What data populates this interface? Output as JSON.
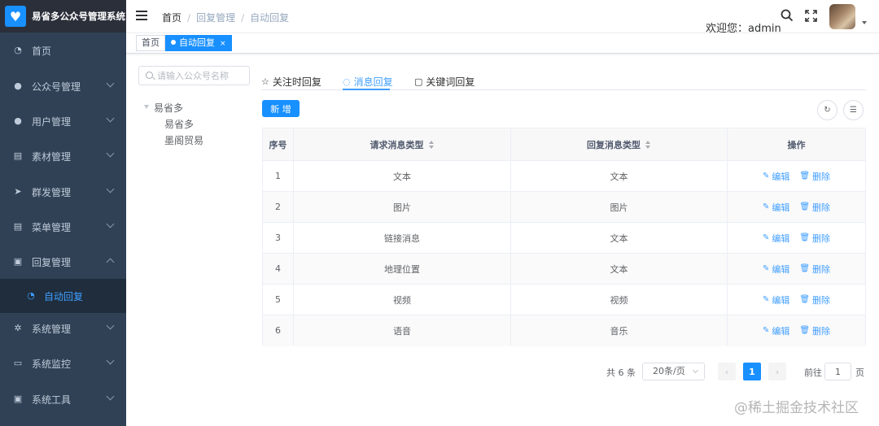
{
  "app": {
    "title": "易省多公众号管理系统",
    "brand_color": "#1890ff"
  },
  "sidebar": {
    "items": [
      {
        "label": "首页",
        "icon": "dashboard-icon"
      },
      {
        "label": "公众号管理",
        "icon": "wechat-icon"
      },
      {
        "label": "用户管理",
        "icon": "user-icon"
      },
      {
        "label": "素材管理",
        "icon": "document-icon"
      },
      {
        "label": "群发管理",
        "icon": "send-icon"
      },
      {
        "label": "菜单管理",
        "icon": "menu-doc-icon"
      },
      {
        "label": "回复管理",
        "icon": "reply-icon"
      },
      {
        "label": "自动回复",
        "icon": "dashboard-icon"
      },
      {
        "label": "系统管理",
        "icon": "gear-icon"
      },
      {
        "label": "系统监控",
        "icon": "monitor-icon"
      },
      {
        "label": "系统工具",
        "icon": "toolbox-icon"
      }
    ]
  },
  "navbar": {
    "breadcrumb": [
      "首页",
      "回复管理",
      "自动回复"
    ],
    "welcome": "欢迎您：admin"
  },
  "tags": {
    "home": "首页",
    "active": "自动回复",
    "close": "×"
  },
  "accounts": {
    "search_placeholder": "请输入公众号名称",
    "tree": {
      "root": "易省多",
      "children": [
        "易省多",
        "墨阁贸易"
      ]
    }
  },
  "reply_tabs": {
    "subscribe": "关注时回复",
    "message": "消息回复",
    "keyword": "关键词回复"
  },
  "toolbar": {
    "add_label": "新 增"
  },
  "table": {
    "headers": {
      "index": "序号",
      "request_type": "请求消息类型",
      "reply_type": "回复消息类型",
      "actions": "操作"
    },
    "rows": [
      {
        "index": "1",
        "request_type": "文本",
        "reply_type": "文本"
      },
      {
        "index": "2",
        "request_type": "图片",
        "reply_type": "图片"
      },
      {
        "index": "3",
        "request_type": "链接消息",
        "reply_type": "文本"
      },
      {
        "index": "4",
        "request_type": "地理位置",
        "reply_type": "文本"
      },
      {
        "index": "5",
        "request_type": "视频",
        "reply_type": "视频"
      },
      {
        "index": "6",
        "request_type": "语音",
        "reply_type": "音乐"
      }
    ],
    "edit_label": "编辑",
    "delete_label": "删除"
  },
  "pagination": {
    "total": "共 6 条",
    "page_size": "20条/页",
    "current_page": "1",
    "goto_label": "前往",
    "goto_value": "1",
    "page_suffix": "页"
  },
  "watermark": "@稀土掘金技术社区"
}
